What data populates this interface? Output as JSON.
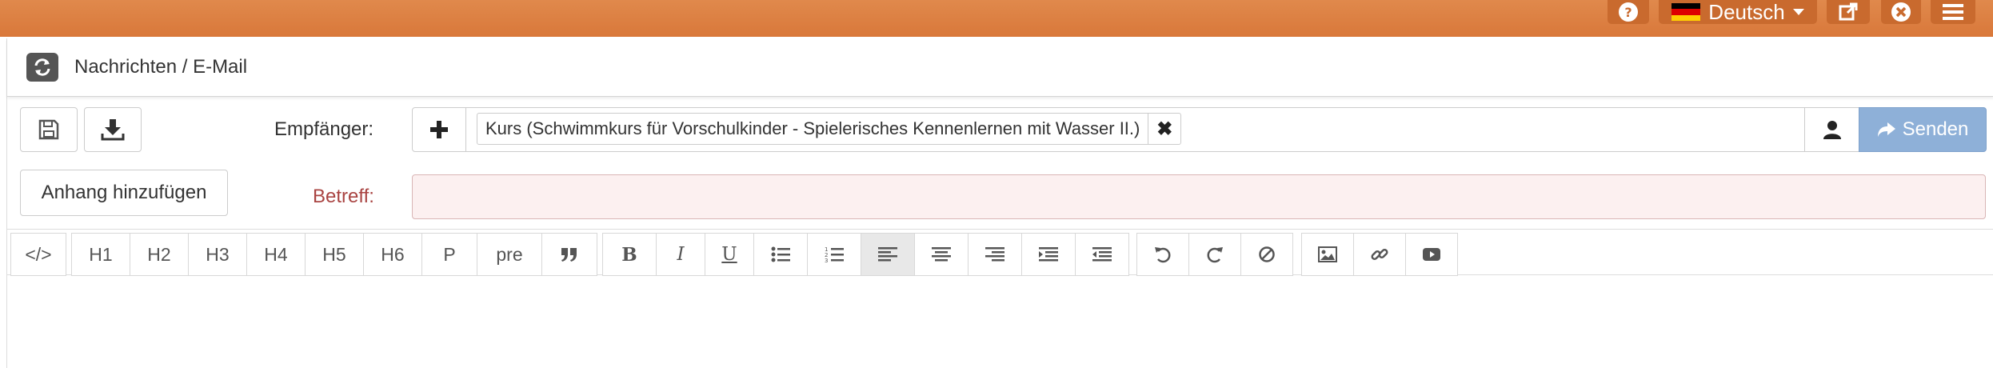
{
  "topbar": {
    "language": "Deutsch",
    "flag_colors": [
      "#000000",
      "#dd0000",
      "#ffce00"
    ],
    "icons": [
      "question-circle-icon",
      "external-link-icon",
      "close-circle-icon",
      "menu-icon"
    ]
  },
  "header": {
    "title": "Nachrichten / E-Mail",
    "refresh_icon": "refresh-icon"
  },
  "form": {
    "recipients_label": "Empfänger:",
    "recipient_tag": "Kurs (Schwimmkurs für Vorschulkinder - Spielerisches Kennenlernen mit Wasser II.)",
    "send_label": "Senden",
    "subject_label": "Betreff:",
    "subject_value": "",
    "attachment_label": "Anhang hinzufügen"
  },
  "toolbar": {
    "code": "</>",
    "headings": [
      "H1",
      "H2",
      "H3",
      "H4",
      "H5",
      "H6",
      "P",
      "pre"
    ],
    "bold": "B",
    "italic": "I",
    "underline": "U"
  },
  "colors": {
    "topbar": "#d9783a",
    "send_button": "#8eb0d8",
    "subject_label": "#a94442",
    "subject_bg": "#fcf0f0"
  }
}
